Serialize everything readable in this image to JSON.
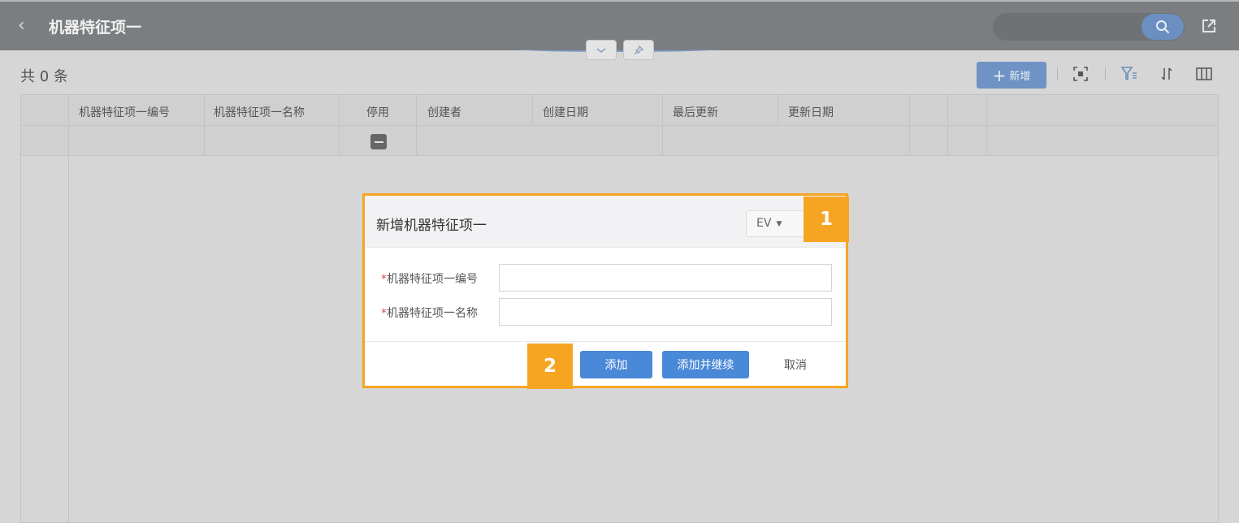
{
  "header": {
    "back_glyph": "‹",
    "title": "机器特征项一"
  },
  "toolbar": {
    "count_text": "共 0 条",
    "add_label": "新增"
  },
  "table": {
    "columns": [
      "机器特征项一编号",
      "机器特征项一名称",
      "停用",
      "创建者",
      "创建日期",
      "最后更新",
      "更新日期"
    ]
  },
  "dialog": {
    "title": "新增机器特征项一",
    "language": "EV",
    "fields": [
      {
        "required_mark": "*",
        "label": "机器特征项一编号",
        "value": ""
      },
      {
        "required_mark": "*",
        "label": "机器特征项一名称",
        "value": ""
      }
    ],
    "buttons": {
      "add": "添加",
      "add_continue": "添加并继续",
      "cancel": "取消"
    }
  },
  "callouts": [
    "1",
    "2"
  ],
  "icons": {
    "back": "chevron-left-icon",
    "search": "search-icon",
    "share": "share-icon",
    "collapse": "chevron-down-icon",
    "pin": "pin-icon",
    "add": "plus-icon",
    "fullscreen": "fullscreen-icon",
    "filter": "filter-icon",
    "sort": "sort-icon",
    "columns": "columns-icon",
    "checkbox": "checkbox-indeterminate-icon"
  },
  "colors": {
    "accent": "#4a88d8",
    "callout": "#f6a523",
    "header": "#7b7e80"
  }
}
